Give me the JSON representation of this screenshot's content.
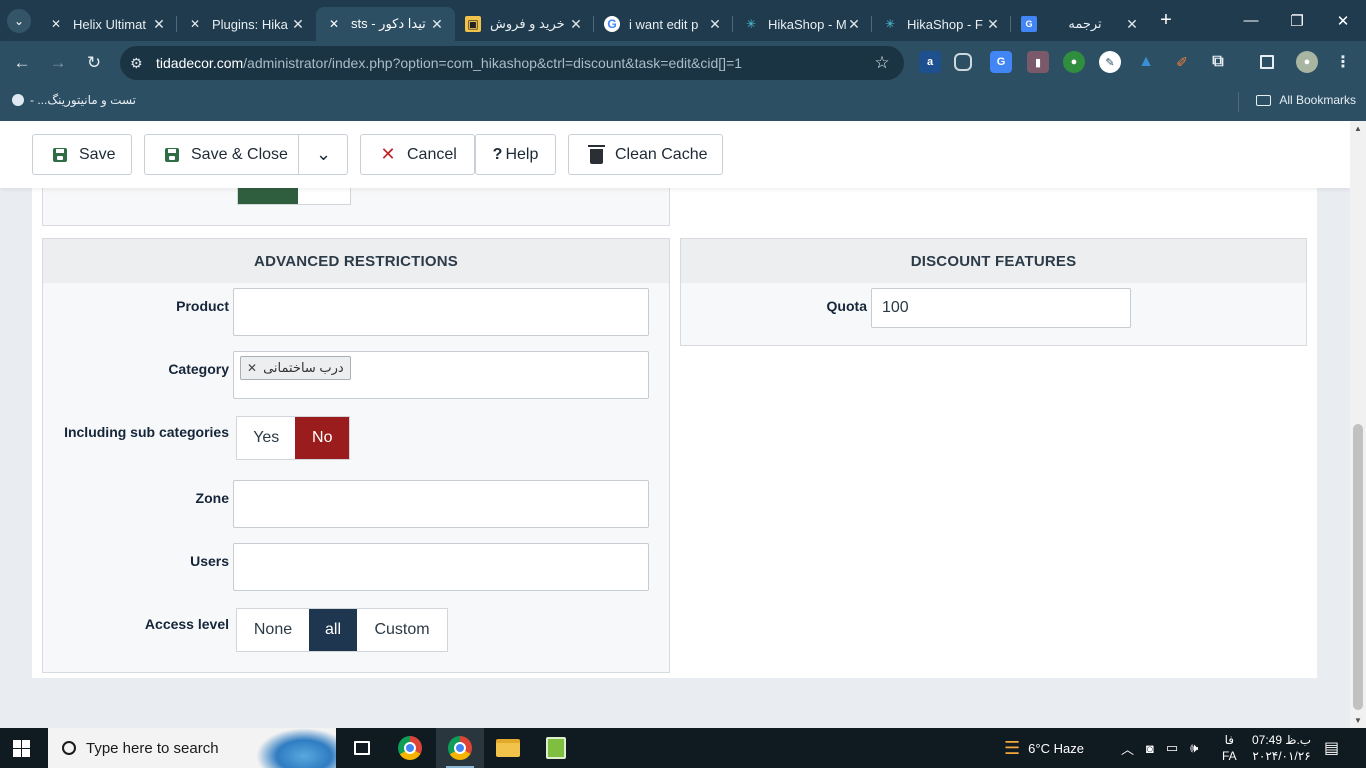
{
  "browser": {
    "tabs": [
      {
        "title": "Helix Ultimat",
        "icon": "joomla-icon",
        "active": false
      },
      {
        "title": "Plugins: Hika",
        "icon": "joomla-icon",
        "active": false
      },
      {
        "title": "تیدا دکور - sts",
        "icon": "joomla-icon",
        "active": true
      },
      {
        "title": "خرید و فروش",
        "icon": "bookmark-site-icon",
        "active": false
      },
      {
        "title": "i want edit p",
        "icon": "google-icon",
        "active": false
      },
      {
        "title": "HikaShop - M",
        "icon": "hikashop-icon",
        "active": false
      },
      {
        "title": "HikaShop - F",
        "icon": "hikashop-icon",
        "active": false
      },
      {
        "title": "ترجمه",
        "icon": "google-translate-icon",
        "active": false
      }
    ],
    "url_host": "tidadecor.com",
    "url_path": "/administrator/index.php?option=com_hikashop&ctrl=discount&task=edit&cid[]=1",
    "bookmarks": {
      "item": "تست و مانیتورینگ... -",
      "all": "All Bookmarks"
    }
  },
  "toolbar": {
    "save": "Save",
    "save_close": "Save & Close",
    "cancel": "Cancel",
    "help": "Help",
    "help_glyph": "?",
    "clean_cache": "Clean Cache"
  },
  "advanced": {
    "title": "ADVANCED RESTRICTIONS",
    "product_label": "Product",
    "category_label": "Category",
    "category_tag": "درب ساختمانی",
    "subcat_label": "Including sub categories",
    "subcat_yes": "Yes",
    "subcat_no": "No",
    "subcat_value": "No",
    "zone_label": "Zone",
    "users_label": "Users",
    "access_label": "Access level",
    "access_none": "None",
    "access_all": "all",
    "access_custom": "Custom",
    "access_value": "all"
  },
  "features": {
    "title": "DISCOUNT FEATURES",
    "quota_label": "Quota",
    "quota_value": "100"
  },
  "taskbar": {
    "search_placeholder": "Type here to search",
    "weather": "6°C  Haze",
    "lang": "FA",
    "lang_fa": "فا",
    "time": "ب.ظ 07:49",
    "date": "۲۰۲۴/۰۱/۲۶"
  },
  "colors": {
    "accent_red": "#9b1c1c",
    "accent_navy": "#1f3650",
    "save_green": "#2f6e45"
  }
}
